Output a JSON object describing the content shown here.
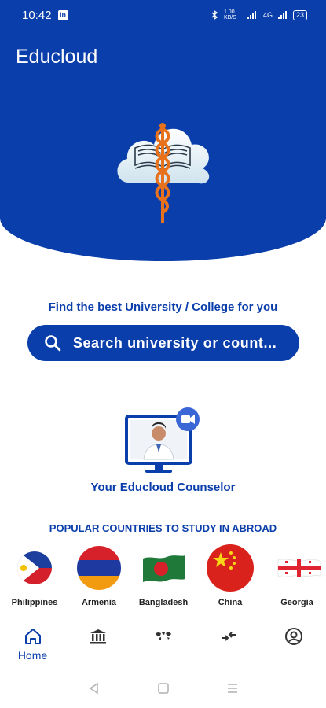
{
  "status_bar": {
    "time": "10:42",
    "linkedin": "in",
    "network": "1.00 KB/S",
    "signal": "4G",
    "battery": "23"
  },
  "header": {
    "title": "Educloud"
  },
  "search": {
    "tagline": "Find the best University / College for you",
    "placeholder": "Search university or count..."
  },
  "counselor": {
    "label": "Your Educloud Counselor"
  },
  "popular": {
    "title": "POPULAR COUNTRIES TO STUDY IN ABROAD",
    "countries": [
      {
        "name": "Philippines"
      },
      {
        "name": "Armenia"
      },
      {
        "name": "Bangladesh"
      },
      {
        "name": "China"
      },
      {
        "name": "Georgia"
      }
    ]
  },
  "tabs": [
    {
      "icon": "home-icon",
      "label": "Home",
      "active": true
    },
    {
      "icon": "institution-icon",
      "label": ""
    },
    {
      "icon": "world-map-icon",
      "label": ""
    },
    {
      "icon": "compare-icon",
      "label": ""
    },
    {
      "icon": "profile-icon",
      "label": ""
    }
  ],
  "colors": {
    "primary": "#0a3eab",
    "accent": "#e8711c"
  }
}
